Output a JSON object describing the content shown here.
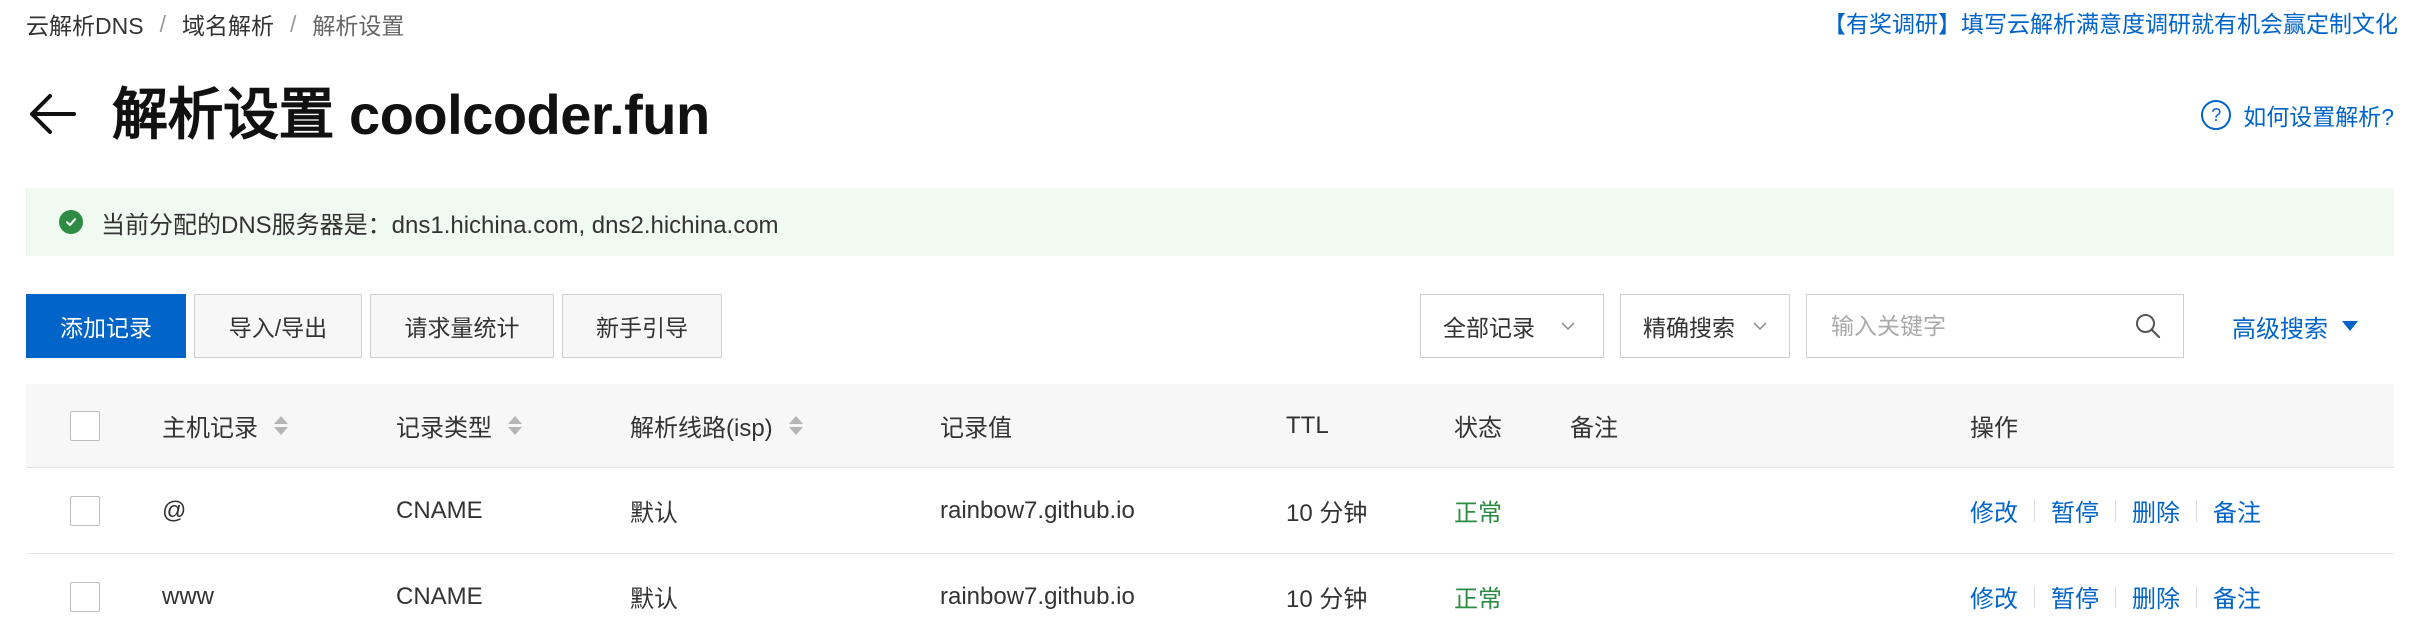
{
  "breadcrumb": {
    "items": [
      "云解析DNS",
      "域名解析",
      "解析设置"
    ],
    "separator": "/"
  },
  "promo_link": "【有奖调研】填写云解析满意度调研就有机会赢定制文化",
  "page": {
    "title": "解析设置 coolcoder.fun",
    "help_link": "如何设置解析?"
  },
  "alert": {
    "text": "当前分配的DNS服务器是：dns1.hichina.com, dns2.hichina.com"
  },
  "toolbar": {
    "add_record": "添加记录",
    "import_export": "导入/导出",
    "request_stats": "请求量统计",
    "beginner_guide": "新手引导",
    "record_filter": "全部记录",
    "search_mode": "精确搜索",
    "search_placeholder": "输入关键字",
    "advanced_search": "高级搜索"
  },
  "table": {
    "columns": [
      "主机记录",
      "记录类型",
      "解析线路(isp)",
      "记录值",
      "TTL",
      "状态",
      "备注",
      "操作"
    ],
    "rows": [
      {
        "host": "@",
        "type": "CNAME",
        "line": "默认",
        "value": "rainbow7.github.io",
        "ttl": "10 分钟",
        "status": "正常",
        "note": ""
      },
      {
        "host": "www",
        "type": "CNAME",
        "line": "默认",
        "value": "rainbow7.github.io",
        "ttl": "10 分钟",
        "status": "正常",
        "note": ""
      }
    ],
    "actions": [
      "修改",
      "暂停",
      "删除",
      "备注"
    ]
  },
  "colors": {
    "primary": "#0064c8",
    "success": "#2e8b43",
    "alert_bg": "#f0faf0"
  },
  "icons": [
    "back-arrow-icon",
    "help-circle-icon",
    "check-circle-icon",
    "chevron-down-icon",
    "search-icon",
    "caret-down-icon",
    "sort-icon"
  ]
}
